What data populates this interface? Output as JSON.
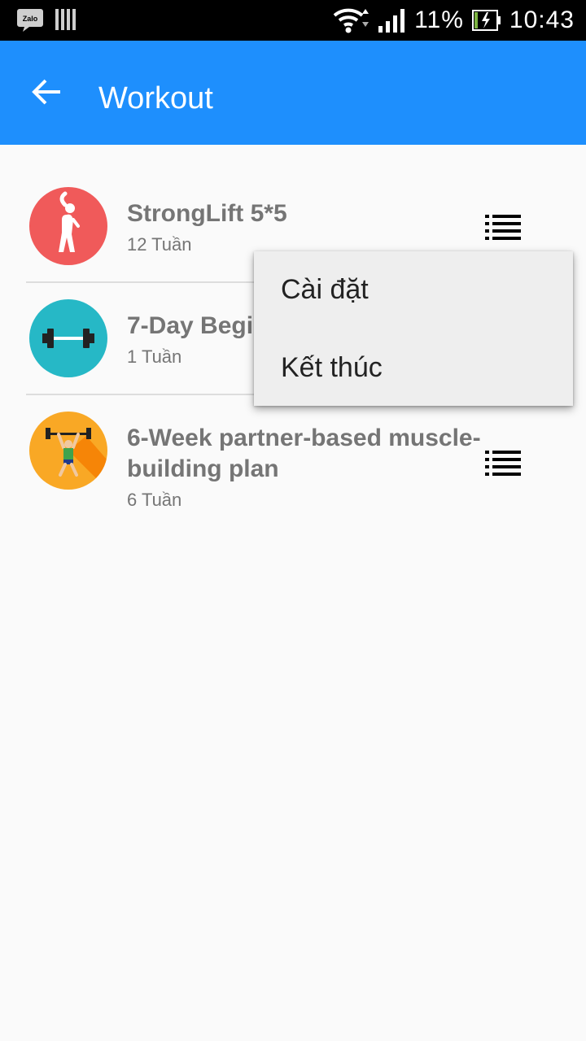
{
  "status_bar": {
    "battery": "11%",
    "time": "10:43",
    "icons": [
      "zalo-icon",
      "barcode-icon",
      "wifi-icon",
      "signal-icon",
      "battery-icon"
    ]
  },
  "app_bar": {
    "title": "Workout",
    "back_icon": "arrow-left-icon",
    "color": "#1e8ffd"
  },
  "workouts": [
    {
      "title": "StrongLift 5*5",
      "duration": "12 Tuần",
      "icon": "stretching-person-icon",
      "color": "#f05a5a"
    },
    {
      "title": "7-Day Begi",
      "duration": "1 Tuần",
      "icon": "barbell-icon",
      "color": "#26b8c6"
    },
    {
      "title": "6-Week partner-based muscle-building plan",
      "duration": "6 Tuần",
      "icon": "weightlifter-icon",
      "color": "#f9a825"
    }
  ],
  "context_menu": {
    "items": [
      "Cài đặt",
      "Kết thúc"
    ]
  }
}
